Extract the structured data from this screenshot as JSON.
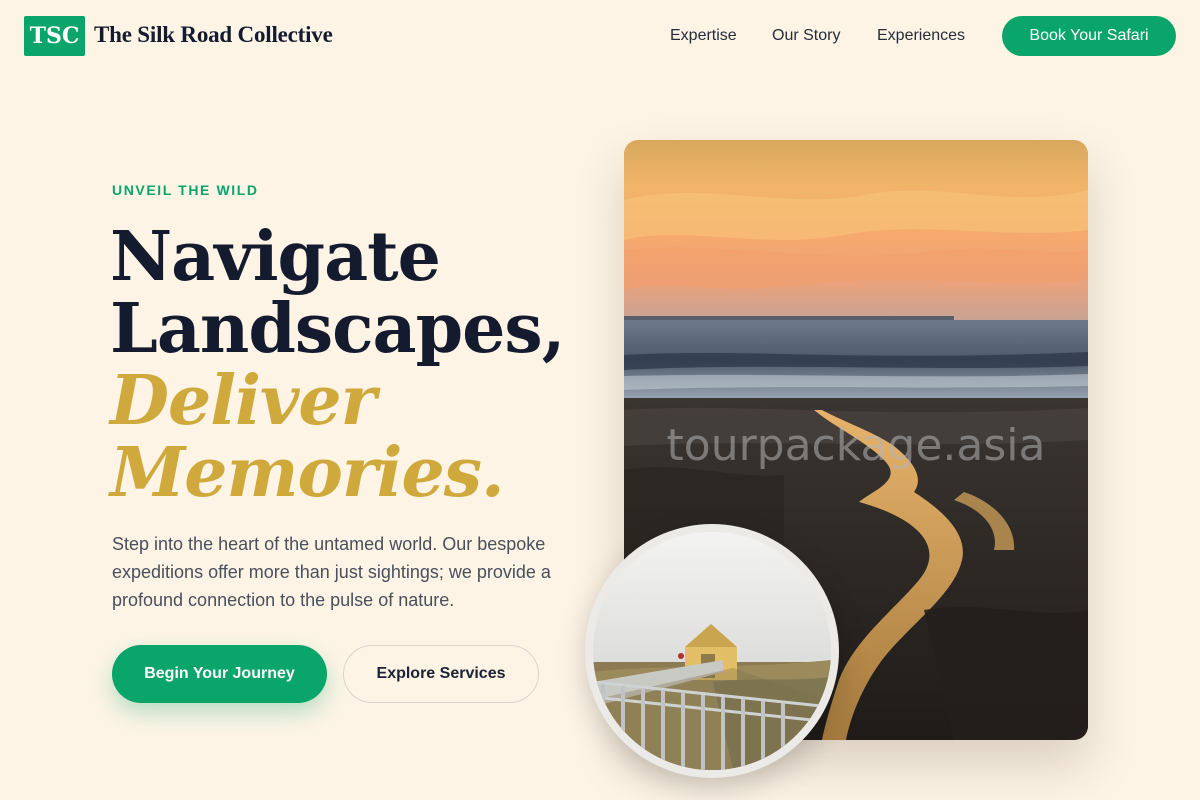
{
  "header": {
    "logo_text": "TSC",
    "brand_name": "The Silk Road Collective",
    "nav": [
      {
        "label": "Expertise"
      },
      {
        "label": "Our Story"
      },
      {
        "label": "Experiences"
      }
    ],
    "cta_label": "Book Your Safari"
  },
  "hero": {
    "eyebrow": "UNVEIL THE WILD",
    "headline": {
      "line1": "Navigate",
      "line2": "Landscapes,",
      "line3": "Deliver",
      "line4": "Memories."
    },
    "lead": "Step into the heart of the untamed world. Our bespoke expeditions offer more than just sightings; we provide a profound connection to the pulse of nature.",
    "primary_button": "Begin Your Journey",
    "secondary_button": "Explore Services",
    "image_watermark": "tourpackage.asia"
  },
  "colors": {
    "accent_green": "#0aa56a",
    "accent_gold": "#cfa93c",
    "background": "#fdf4e6",
    "ink": "#141b2e"
  }
}
